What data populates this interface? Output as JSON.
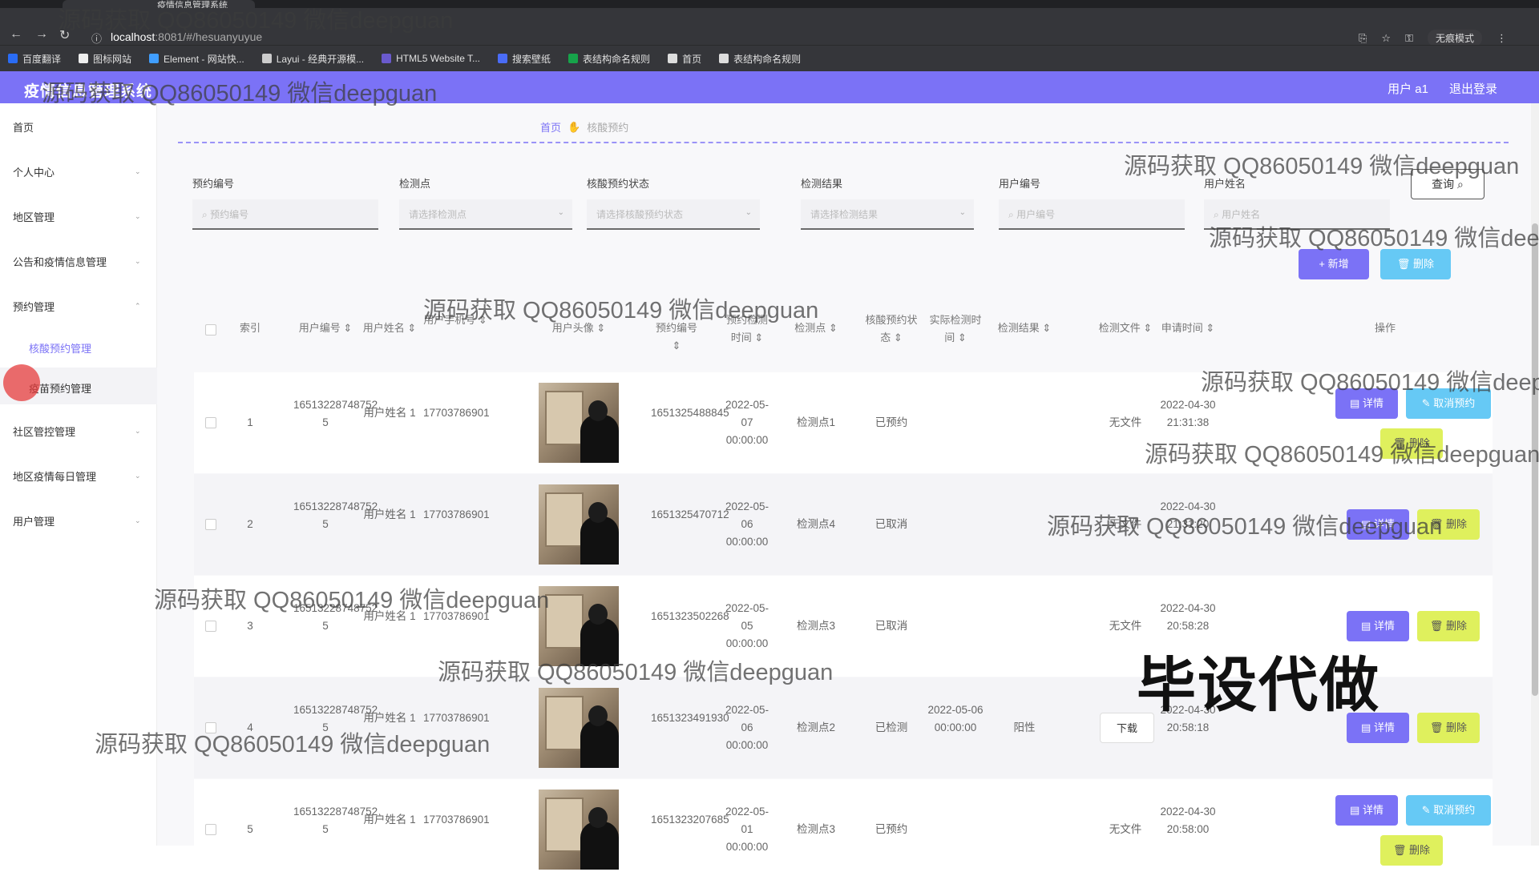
{
  "browser": {
    "tab_title": "疫情信息管理系统",
    "url_host": "localhost",
    "url_rest": ":8081/#/hesuanyuyue",
    "incognito_label": "无痕模式",
    "bookmarks": [
      {
        "label": "百度翻译",
        "color": "#2a6cf5"
      },
      {
        "label": "图标网站",
        "color": "#eeeeee"
      },
      {
        "label": "Element - 网站快...",
        "color": "#409eff"
      },
      {
        "label": "Layui - 经典开源模...",
        "color": "#cccccc"
      },
      {
        "label": "HTML5 Website T...",
        "color": "#6a5acd"
      },
      {
        "label": "搜索壁纸",
        "color": "#4a6cf7"
      },
      {
        "label": "表结构命名规则",
        "color": "#16a34a"
      },
      {
        "label": "首页",
        "color": "#dddddd"
      },
      {
        "label": "表结构命名规则",
        "color": "#dddddd"
      }
    ]
  },
  "header": {
    "title": "疫情信息管理系统",
    "user_label": "用户 a1",
    "logout_label": "退出登录"
  },
  "sidebar": {
    "items": [
      {
        "label": "首页",
        "has_arrow": false
      },
      {
        "label": "个人中心",
        "has_arrow": true
      },
      {
        "label": "地区管理",
        "has_arrow": true
      },
      {
        "label": "公告和疫情信息管理",
        "has_arrow": true
      },
      {
        "label": "预约管理",
        "has_arrow": true
      },
      {
        "label": "社区管控管理",
        "has_arrow": true
      },
      {
        "label": "地区疫情每日管理",
        "has_arrow": true
      },
      {
        "label": "用户管理",
        "has_arrow": true
      }
    ],
    "subitems": [
      "核酸预约管理",
      "疫苗预约管理"
    ]
  },
  "breadcrumb": {
    "home": "首页",
    "current": "核酸预约"
  },
  "filters": [
    {
      "label": "预约编号",
      "placeholder": "预约编号",
      "type": "input"
    },
    {
      "label": "检测点",
      "placeholder": "请选择检测点",
      "type": "select"
    },
    {
      "label": "核酸预约状态",
      "placeholder": "请选择核酸预约状态",
      "type": "select"
    },
    {
      "label": "检测结果",
      "placeholder": "请选择检测结果",
      "type": "select"
    },
    {
      "label": "用户编号",
      "placeholder": "用户编号",
      "type": "input"
    },
    {
      "label": "用户姓名",
      "placeholder": "用户姓名",
      "type": "input"
    }
  ],
  "actions": {
    "query": "查询",
    "add": "+ 新增",
    "delete": "删除"
  },
  "table": {
    "columns": [
      "索引",
      "用户编号",
      "用户姓名",
      "用户手机号",
      "用户头像",
      "预约编号",
      "预约检测时间",
      "检测点",
      "核酸预约状态",
      "实际检测时间",
      "检测结果",
      "检测文件",
      "申请时间",
      "操作"
    ],
    "rows": [
      {
        "index": "1",
        "user_no": "16513228748752 5",
        "user_name": "用户姓名 1",
        "phone": "17703786901",
        "booking_no": "1651325488845",
        "booking_time": "2022-05-07 00:00:00",
        "site": "检测点1",
        "status": "已预约",
        "actual_time": "",
        "result": "",
        "file": "无文件",
        "apply_time": "2022-04-30 21:31:38",
        "can_cancel": true
      },
      {
        "index": "2",
        "user_no": "16513228748752 5",
        "user_name": "用户姓名 1",
        "phone": "17703786901",
        "booking_no": "1651325470712",
        "booking_time": "2022-05-06 00:00:00",
        "site": "检测点4",
        "status": "已取消",
        "actual_time": "",
        "result": "",
        "file": "无文件",
        "apply_time": "2022-04-30 21:31:20",
        "can_cancel": false
      },
      {
        "index": "3",
        "user_no": "16513228748752 5",
        "user_name": "用户姓名 1",
        "phone": "17703786901",
        "booking_no": "1651323502268",
        "booking_time": "2022-05-05 00:00:00",
        "site": "检测点3",
        "status": "已取消",
        "actual_time": "",
        "result": "",
        "file": "无文件",
        "apply_time": "2022-04-30 20:58:28",
        "can_cancel": false
      },
      {
        "index": "4",
        "user_no": "16513228748752 5",
        "user_name": "用户姓名 1",
        "phone": "17703786901",
        "booking_no": "1651323491930",
        "booking_time": "2022-05-06 00:00:00",
        "site": "检测点2",
        "status": "已检测",
        "actual_time": "2022-05-06 00:00:00",
        "result": "阳性",
        "file": "下载",
        "apply_time": "2022-04-30 20:58:18",
        "can_cancel": false
      },
      {
        "index": "5",
        "user_no": "16513228748752 5",
        "user_name": "用户姓名 1",
        "phone": "17703786901",
        "booking_no": "1651323207685",
        "booking_time": "2022-05-01 00:00:00",
        "site": "检测点3",
        "status": "已预约",
        "actual_time": "",
        "result": "",
        "file": "无文件",
        "apply_time": "2022-04-30 20:58:00",
        "can_cancel": true
      }
    ],
    "row_buttons": {
      "detail": "详情",
      "cancel": "取消预约",
      "delete": "删除"
    }
  },
  "overlay": {
    "watermark": "源码获取 QQ86050149 微信deepguan",
    "big_text": "毕设代做"
  }
}
